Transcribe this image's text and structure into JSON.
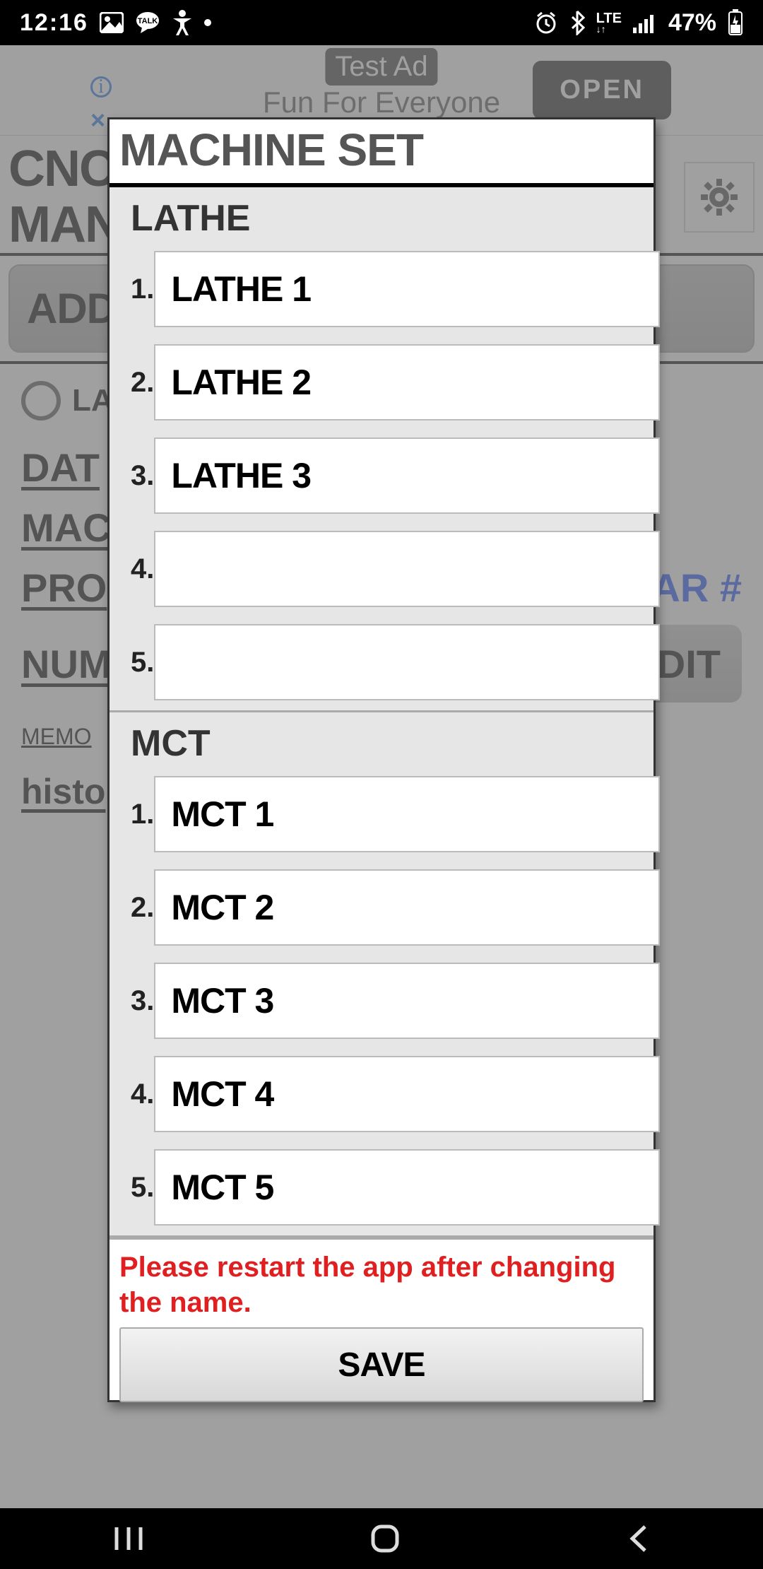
{
  "status": {
    "time": "12:16",
    "right_icons": [
      "alarm",
      "bt",
      "lte",
      "signal"
    ],
    "battery_pct": "47%"
  },
  "ad": {
    "badge": "Test Ad",
    "text": "Fun For Everyone",
    "open": "OPEN"
  },
  "app": {
    "title_line1": "CNC",
    "title_line2": "MAN",
    "gear": "⚙"
  },
  "addbtn": "ADD",
  "bg_labels": {
    "radio": "LA",
    "date": "DAT",
    "mac": "MAC",
    "pro": "PRO",
    "ar_hash": "AR #",
    "num": "NUM",
    "edit": "DIT",
    "memo": "MEMO",
    "history": "histo"
  },
  "dialog": {
    "title": "MACHINE SET",
    "sections": [
      {
        "title": "LATHE",
        "rows": [
          {
            "num": "1.",
            "value": "LATHE 1"
          },
          {
            "num": "2.",
            "value": "LATHE 2"
          },
          {
            "num": "3.",
            "value": "LATHE 3"
          },
          {
            "num": "4.",
            "value": ""
          },
          {
            "num": "5.",
            "value": ""
          }
        ]
      },
      {
        "title": "MCT",
        "rows": [
          {
            "num": "1.",
            "value": "MCT 1"
          },
          {
            "num": "2.",
            "value": "MCT 2"
          },
          {
            "num": "3.",
            "value": "MCT 3"
          },
          {
            "num": "4.",
            "value": "MCT 4"
          },
          {
            "num": "5.",
            "value": "MCT 5"
          }
        ]
      }
    ],
    "warning": "Please restart the app after changing the name.",
    "save": "SAVE"
  }
}
